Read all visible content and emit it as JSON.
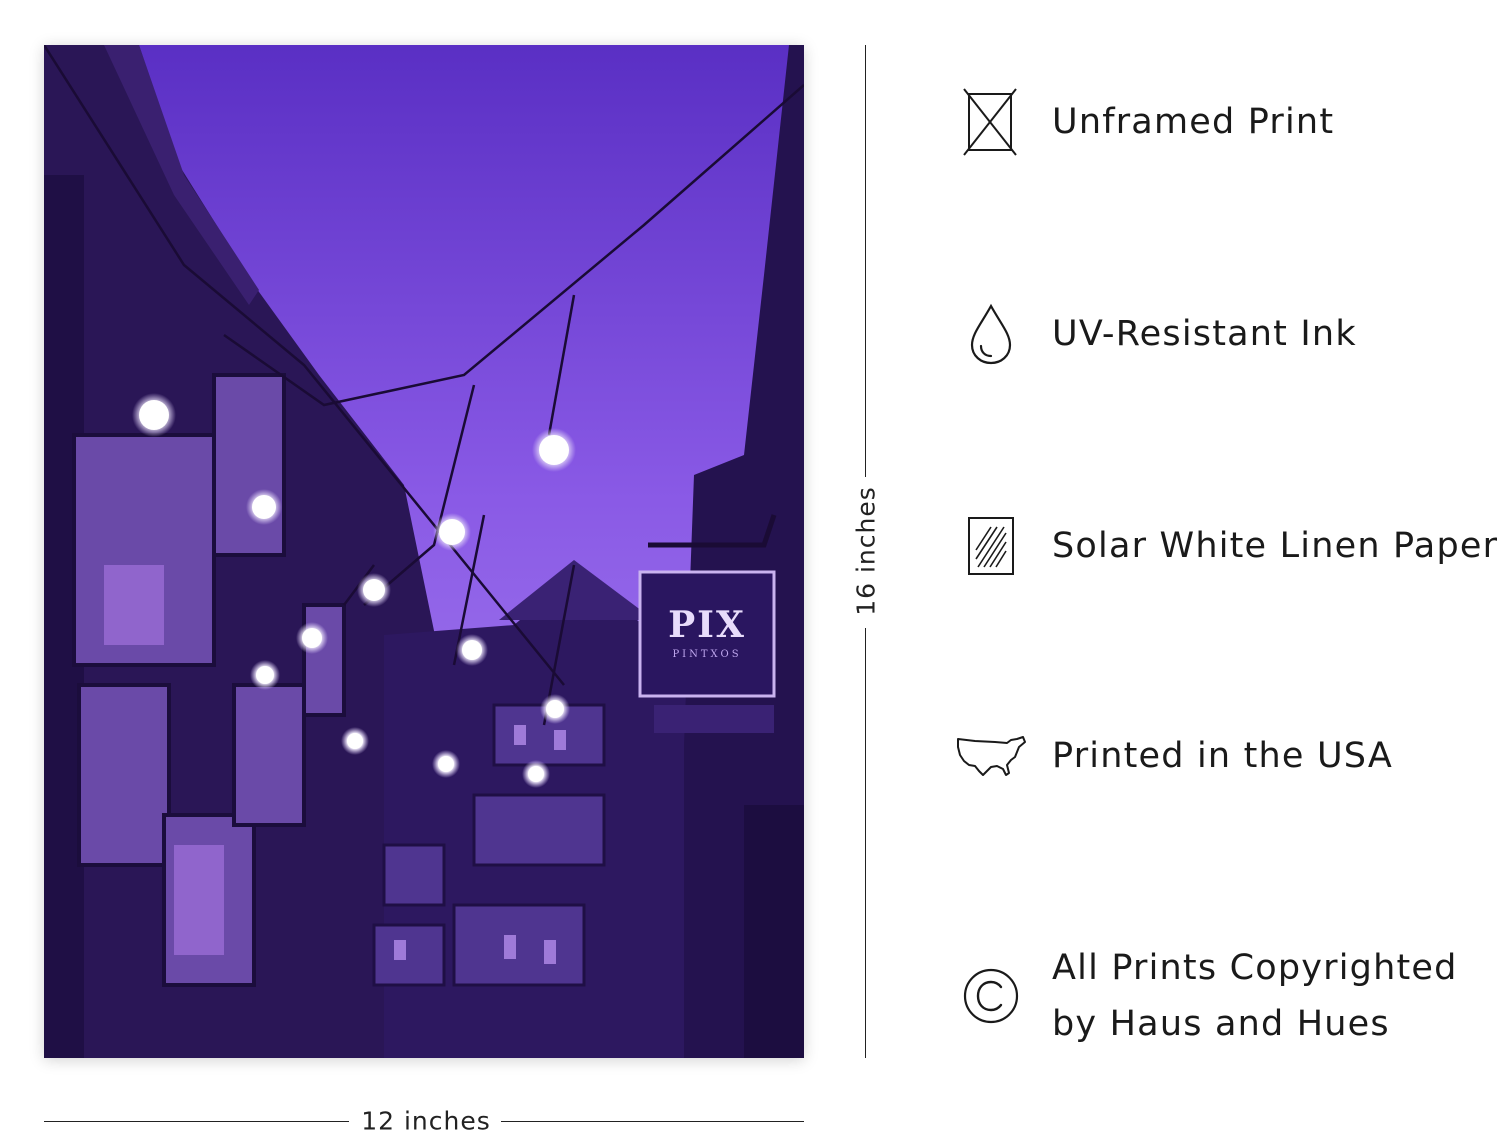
{
  "dimensions": {
    "height_label": "16 inches",
    "width_label": "12 inches"
  },
  "print": {
    "sign_text": "PIX",
    "sign_subtext": "PINTXOS"
  },
  "features": [
    {
      "icon": "unframed-print-icon",
      "label": "Unframed Print"
    },
    {
      "icon": "ink-drop-icon",
      "label": "UV-Resistant Ink"
    },
    {
      "icon": "linen-paper-icon",
      "label": "Solar White Linen Paper"
    },
    {
      "icon": "usa-map-icon",
      "label": "Printed in the USA"
    },
    {
      "icon": "copyright-icon",
      "label_line1": "All Prints Copyrighted",
      "label_line2": "by Haus and Hues"
    }
  ]
}
